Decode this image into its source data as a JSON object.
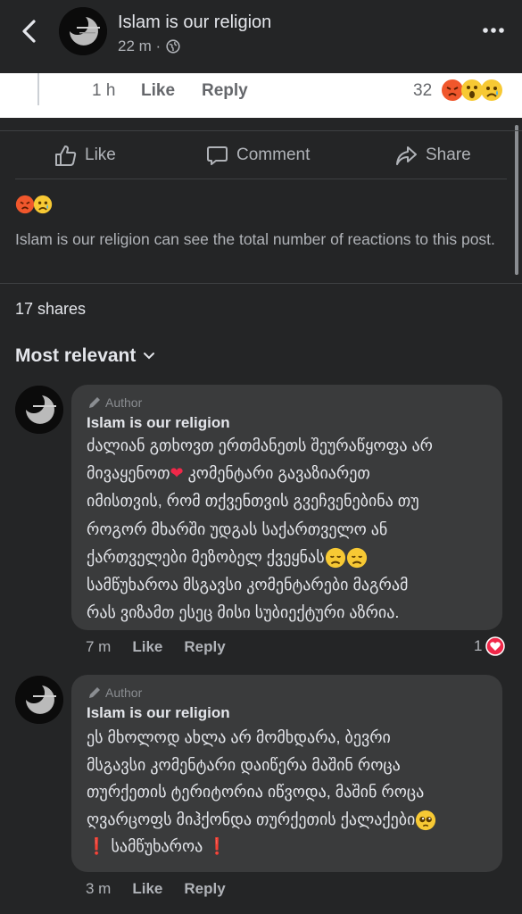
{
  "header": {
    "title": "Islam is our religion",
    "subtitle": "22 m ·"
  },
  "prev_comment_strip": {
    "time": "1 h",
    "like": "Like",
    "reply": "Reply",
    "reaction_count": "32"
  },
  "actions": {
    "like": "Like",
    "comment": "Comment",
    "share": "Share"
  },
  "reaction_note": "Islam is our religion can see the total number of reactions to this post.",
  "shares": "17 shares",
  "sort_label": "Most relevant",
  "comments": [
    {
      "author_tag": "Author",
      "name": "Islam is our religion",
      "lines": [
        "ძალიან გთხოვთ ერთმანეთს შეურაწყოფა არ",
        "მივაყენოთ",
        "კომენტარი გავაზიარეთ",
        "იმისთვის, რომ თქვენთვის გვეჩვენებინა თუ",
        "როგორ მხარში უდგას საქართველო ან",
        "ქართველები მეზობელ ქვეყნას",
        "სამწუხაროა მსგავსი კომენტარები მაგრამ",
        "რას ვიზამთ ესეც მისი სუბიექტური აზრია."
      ],
      "time": "7 m",
      "like": "Like",
      "reply": "Reply",
      "likes": "1"
    },
    {
      "author_tag": "Author",
      "name": "Islam is our religion",
      "lines": [
        "ეს მხოლოდ ახლა არ მომხდარა, ბევრი",
        "მსგავსი კომენტარი დაიწერა მაშინ როცა",
        "თურქეთის ტერიტორია იწვოდა, მაშინ როცა",
        "ღვარცოფს მიჰქონდა თურქეთის ქალაქები",
        "სამწუხაროა"
      ],
      "time": "3 m",
      "like": "Like",
      "reply": "Reply"
    }
  ],
  "icons": {
    "back": "chevron-left-icon",
    "more": "more-dots-icon",
    "globe": "globe-icon",
    "like": "thumbs-up-icon",
    "comment": "comment-icon",
    "share": "share-arrow-icon",
    "author": "pencil-icon",
    "sort": "chevron-down-icon"
  },
  "colors": {
    "background": "#242526",
    "bubble": "#3a3b3c",
    "text": "#e4e6eb",
    "muted": "#b0b3b8",
    "heart": "#f02849"
  }
}
